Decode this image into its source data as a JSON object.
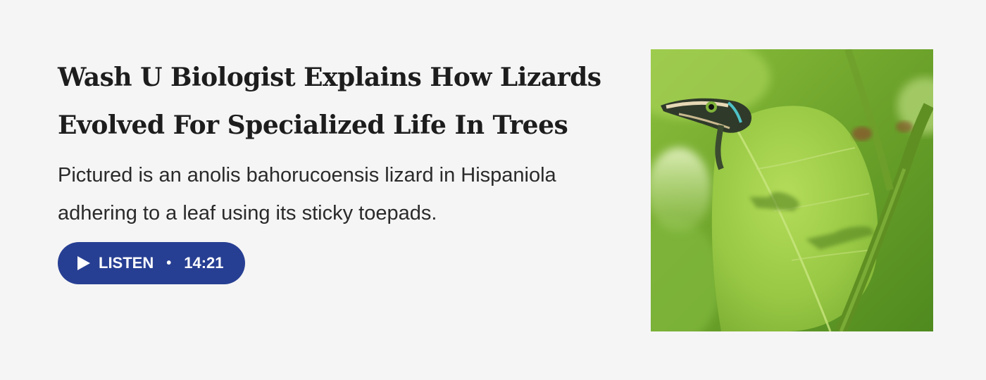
{
  "article": {
    "headline": "Wash U Biologist Explains How Lizards Evolved For Specialized Life In Trees",
    "summary": "Pictured is an anolis bahorucoensis lizard in Hispaniola adhering to a leaf using its sticky toepads.",
    "listen": {
      "icon": "play-icon",
      "label": "LISTEN",
      "separator": "•",
      "duration": "14:21"
    },
    "image": {
      "icon": "lizard-photo",
      "alt": ""
    }
  },
  "colors": {
    "background": "#f5f5f5",
    "headline": "#1d1d1d",
    "button": "#273f93",
    "button_text": "#ffffff"
  }
}
